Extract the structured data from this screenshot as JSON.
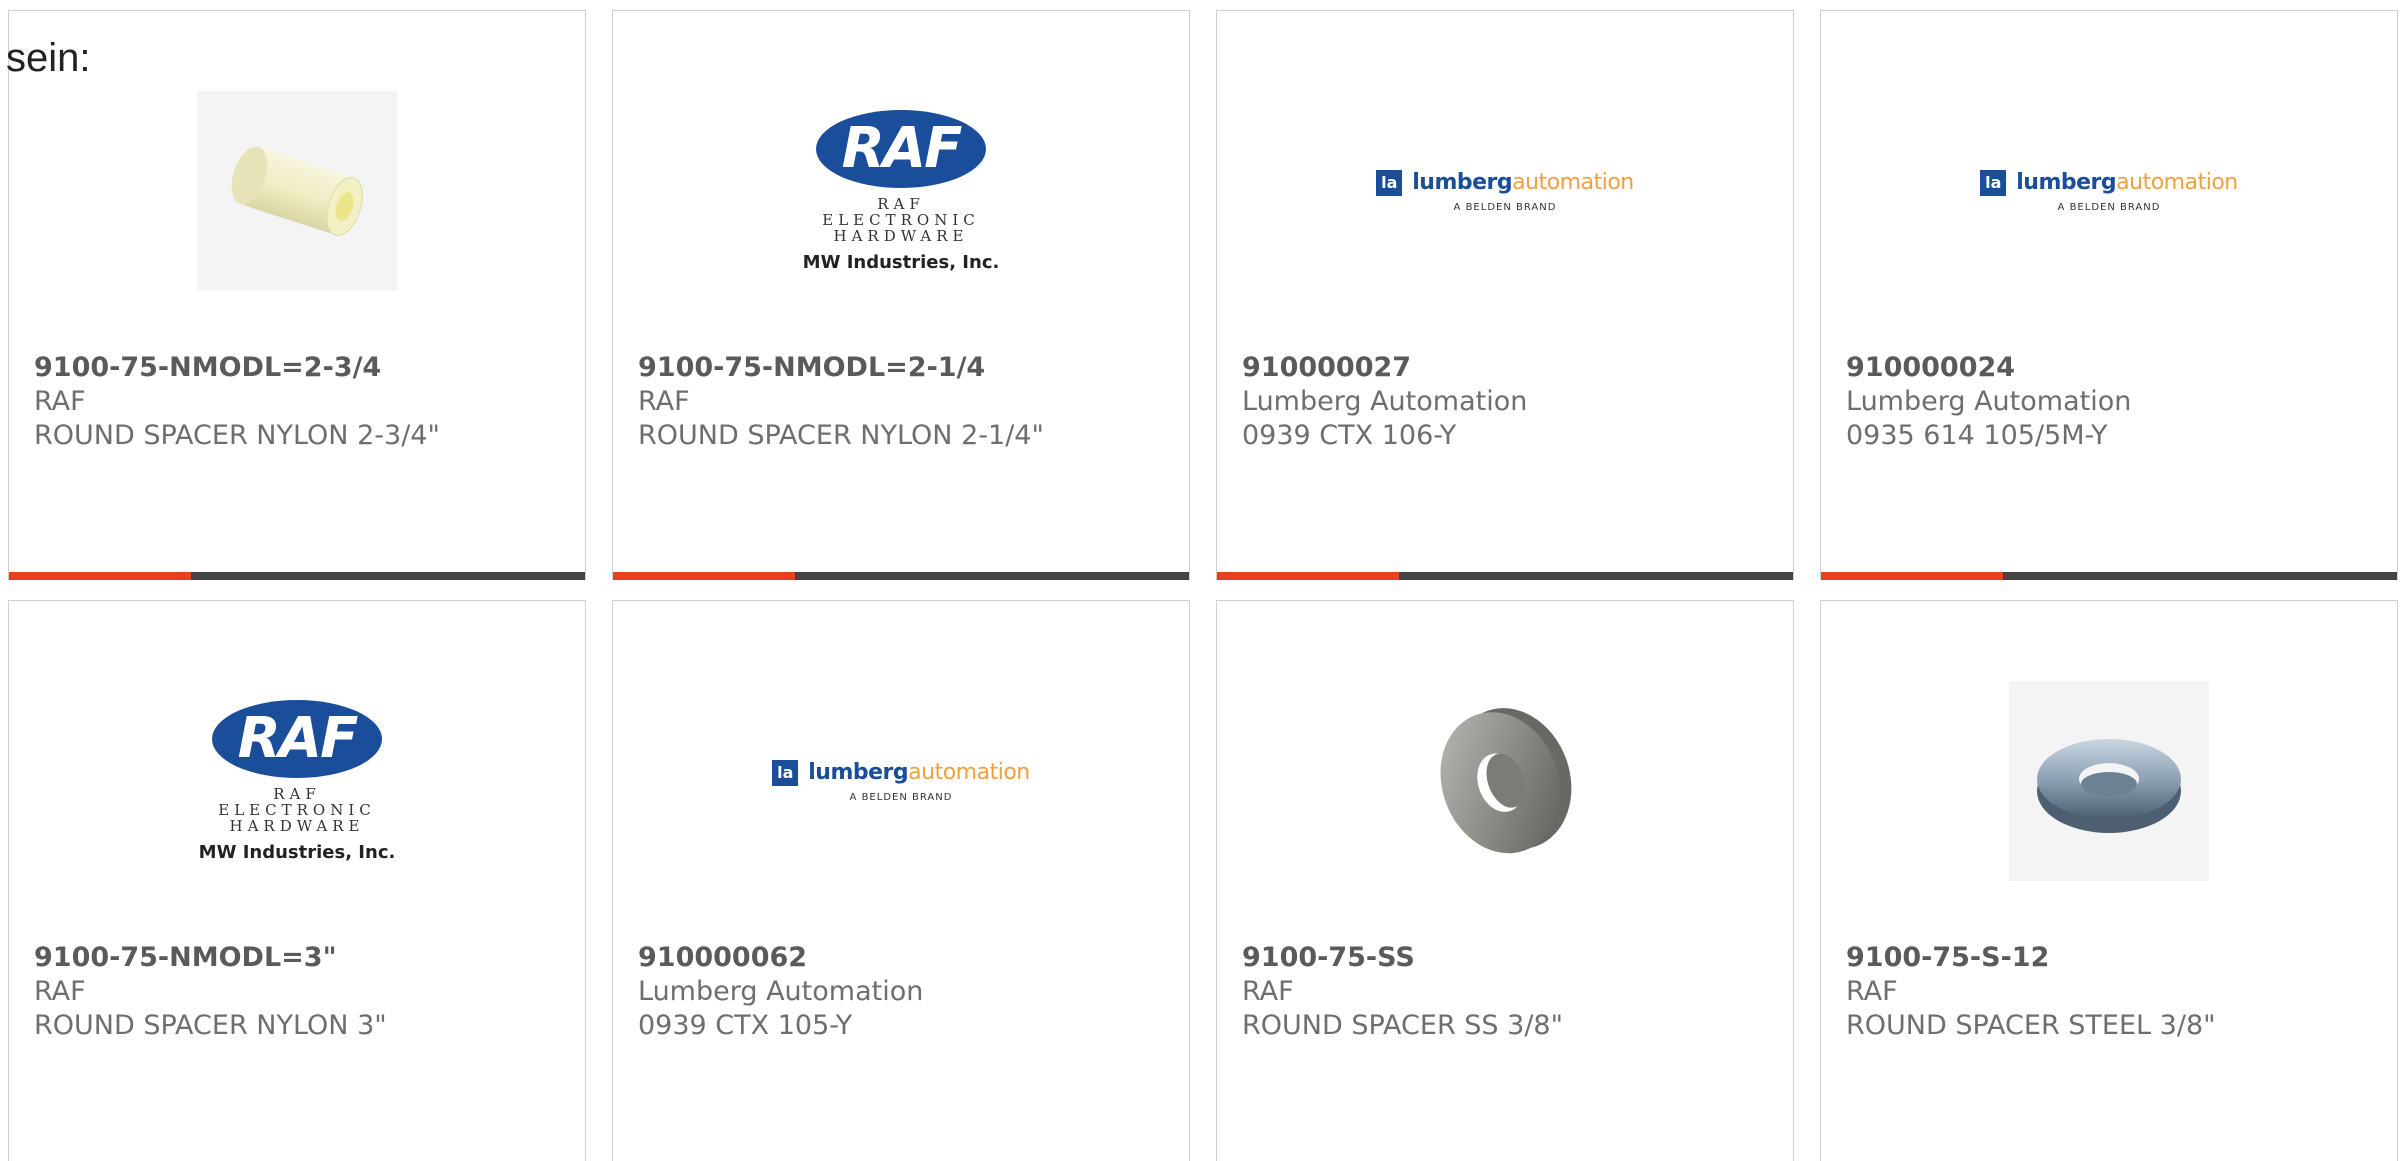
{
  "intro_text": "sein:",
  "brands": {
    "raf_mark": "RAF",
    "raf_line1": "RAF ELECTRONIC",
    "raf_line2": "HARDWARE",
    "raf_parent": "MW Industries, Inc.",
    "lumberg_box": "la",
    "lumberg_word1": "lumberg",
    "lumberg_word2": "automation",
    "lumberg_sub": "A BELDEN BRAND"
  },
  "products": [
    {
      "part_number": "9100-75-NMODL=2-3/4",
      "manufacturer": "RAF",
      "description": "ROUND SPACER NYLON 2-3/4\"",
      "image": "nylon-spacer-photo"
    },
    {
      "part_number": "9100-75-NMODL=2-1/4",
      "manufacturer": "RAF",
      "description": "ROUND SPACER NYLON 2-1/4\"",
      "image": "raf-logo"
    },
    {
      "part_number": "910000027",
      "manufacturer": "Lumberg Automation",
      "description": "0939 CTX 106-Y",
      "image": "lumberg-logo"
    },
    {
      "part_number": "910000024",
      "manufacturer": "Lumberg Automation",
      "description": "0935 614 105/5M-Y",
      "image": "lumberg-logo"
    },
    {
      "part_number": "9100-75-NMODL=3\"",
      "manufacturer": "RAF",
      "description": "ROUND SPACER NYLON 3\"",
      "image": "raf-logo"
    },
    {
      "part_number": "910000062",
      "manufacturer": "Lumberg Automation",
      "description": "0939 CTX 105-Y",
      "image": "lumberg-logo"
    },
    {
      "part_number": "9100-75-SS",
      "manufacturer": "RAF",
      "description": "ROUND SPACER SS 3/8\"",
      "image": "steel-spacer-photo"
    },
    {
      "part_number": "9100-75-S-12",
      "manufacturer": "RAF",
      "description": "ROUND SPACER STEEL 3/8\"",
      "image": "steel-washer-photo"
    }
  ],
  "colors": {
    "accent_bar": "#e8411f",
    "bar_dark": "#444444",
    "raf_blue": "#1a4e9a",
    "lumberg_orange": "#f0a03c"
  }
}
